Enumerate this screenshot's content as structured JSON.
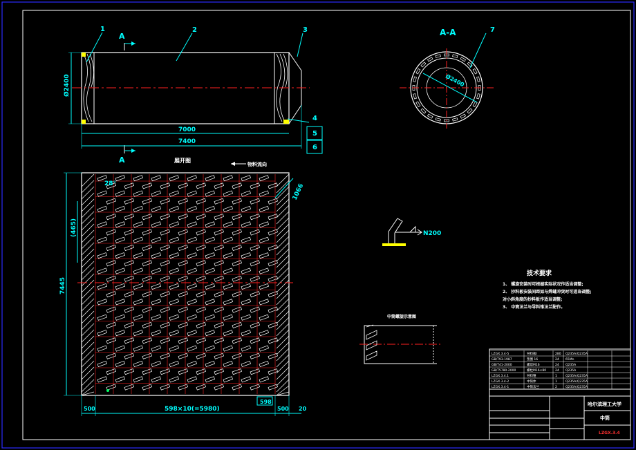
{
  "colors": {
    "background": "#000000",
    "frame": "#2b2bff",
    "outline": "#ffffff",
    "dimension": "#00ffff",
    "centerline": "#ff2020",
    "grid": "#ff2020",
    "label": "#00ff66",
    "leader": "#00ffff",
    "hatch": "#ffffff",
    "weld": "#ffff00",
    "stamp": "#ff3030"
  },
  "views": {
    "section_mark_top": "A",
    "section_mark_bottom": "A",
    "section_view_title": "A-A",
    "development_title": "展开图",
    "flow_direction": "物料流向",
    "middle_section_title": "中筒螺旋示意图",
    "section_diameter": "Ø2400"
  },
  "part_numbers": [
    "1",
    "2",
    "3",
    "4",
    "5",
    "6",
    "7"
  ],
  "dimensions": {
    "diameter": "Ø2400",
    "inner_length": "7000",
    "overall_length": "7400",
    "height": "7445",
    "pitch_row": "(465)",
    "angle": "28°",
    "corner": "1066",
    "pitch_total": "598×10(=5980)",
    "pitch_single": "598",
    "left_margin": "500",
    "right_margin": "500",
    "edge": "20",
    "weld_symbol": "N200"
  },
  "technical_requirements": {
    "title": "技术要求",
    "items": [
      "1、 螺旋安装时可根据实际状况作适当调整;",
      "2、 抄料板安装间距如与焊缝冲突时可适当调整;",
      "   对小斜角度的抄料板作适当调整;",
      "3、 中筒法兰与导料锥法兰配作。"
    ]
  },
  "title_block": {
    "rows": [
      {
        "code": "LZGX.3.4-5",
        "name": "导料板Ⅰ",
        "qty": "280",
        "material": "Q235A/Q235A"
      },
      {
        "code": "GB/T93-1987",
        "name": "垫圈 16",
        "qty": "24",
        "material": "65Mn"
      },
      {
        "code": "GB/T41-2000",
        "name": "螺母M16",
        "qty": "24",
        "material": "Q235A"
      },
      {
        "code": "GB/T5780-2000",
        "name": "螺栓M16×80",
        "qty": "24",
        "material": "Q235A"
      },
      {
        "code": "LZGX.3.4.1",
        "name": "导料锥",
        "qty": "1",
        "material": "Q235A/Q235A"
      },
      {
        "code": "LZGX.3.4-2",
        "name": "中筒体",
        "qty": "1",
        "material": "Q235A/Q235A"
      },
      {
        "code": "LZGX.3.4-1",
        "name": "中筒法兰",
        "qty": "2",
        "material": "Q235A/Q235A"
      }
    ],
    "university": "哈尔滨理工大学",
    "drawing_name": "中筒",
    "drawing_code": "LZGX.3.4"
  }
}
